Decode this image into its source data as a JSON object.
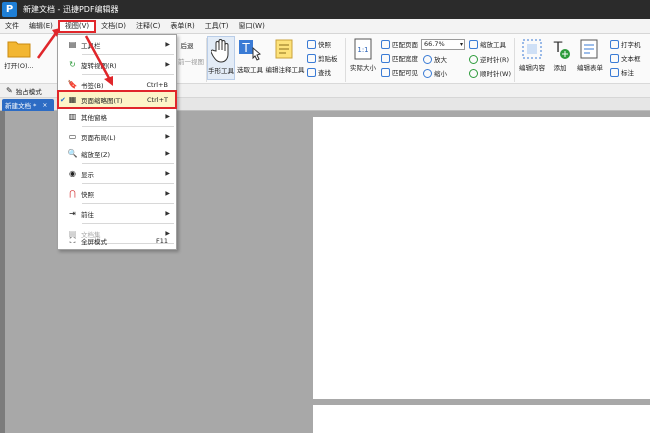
{
  "window": {
    "app_logo": "P",
    "title": "新建文档 - 迅捷PDF编辑器"
  },
  "menubar": [
    {
      "label": "文件"
    },
    {
      "label": "编辑(E)"
    },
    {
      "label": "视图(V)",
      "active": true
    },
    {
      "label": "文档(D)"
    },
    {
      "label": "注释(C)"
    },
    {
      "label": "表单(R)"
    },
    {
      "label": "工具(T)"
    },
    {
      "label": "窗口(W)"
    }
  ],
  "ribbon": {
    "open_label": "打开(O)...",
    "back_label": "后退",
    "forward_label": "前一视图",
    "hand_tool": "手形工具",
    "select_tool": "选取工具",
    "edit_annot_tool": "编辑注释工具",
    "snapshot": "快照",
    "clipboard": "剪贴板",
    "find": "查找",
    "actual_size": "实际大小",
    "fit_page": "匹配页面",
    "fit_width": "匹配宽度",
    "fit_visible": "匹配可见",
    "zoom_value": "66.7%",
    "zoom_tool": "缩放工具",
    "zoom_in": "放大",
    "zoom_out": "缩小",
    "rotate_ccw": "逆时针(R)",
    "rotate_cw": "顺时针(W)",
    "edit_content": "编辑内容",
    "add": "添加",
    "edit_form": "编辑表单",
    "typewriter": "打字机",
    "textbox": "文本框",
    "callout": "标注"
  },
  "row2": {
    "exclusive_mode": "独占模式"
  },
  "doc_tab": {
    "label": "新建文档 *",
    "close": "×"
  },
  "view_menu": {
    "items": [
      {
        "label": "工具栏",
        "icon": "toolbar-icon",
        "submenu": true
      },
      {
        "label": "旋转视图(R)",
        "icon": "rotate-icon",
        "submenu": true
      },
      {
        "label": "书签(B)",
        "icon": "bookmark-icon",
        "shortcut": "Ctrl+B"
      },
      {
        "label": "页面缩略图(T)",
        "icon": "thumbnail-icon",
        "shortcut": "Ctrl+T",
        "checked": true,
        "highlighted": true
      },
      {
        "label": "其他窗格",
        "icon": "pane-icon",
        "submenu": true
      },
      {
        "label": "页面布局(L)",
        "icon": "layout-icon",
        "submenu": true
      },
      {
        "label": "缩放至(Z)",
        "icon": "zoom-to-icon",
        "submenu": true
      },
      {
        "label": "显示",
        "icon": "display-icon",
        "submenu": true
      },
      {
        "label": "快照",
        "icon": "magnet-icon",
        "submenu": true
      },
      {
        "label": "前往",
        "icon": "goto-icon",
        "submenu": true
      },
      {
        "label": "文档集",
        "icon": "portfolio-icon",
        "submenu": true,
        "disabled": true
      },
      {
        "label": "全屏模式",
        "icon": "fullscreen-icon",
        "shortcut": "F11"
      }
    ]
  },
  "colors": {
    "highlight_border": "#e0262b",
    "highlight_fill": "#fdf4c8",
    "tab_blue": "#2d6cc4",
    "workspace": "#a8a8a8"
  }
}
